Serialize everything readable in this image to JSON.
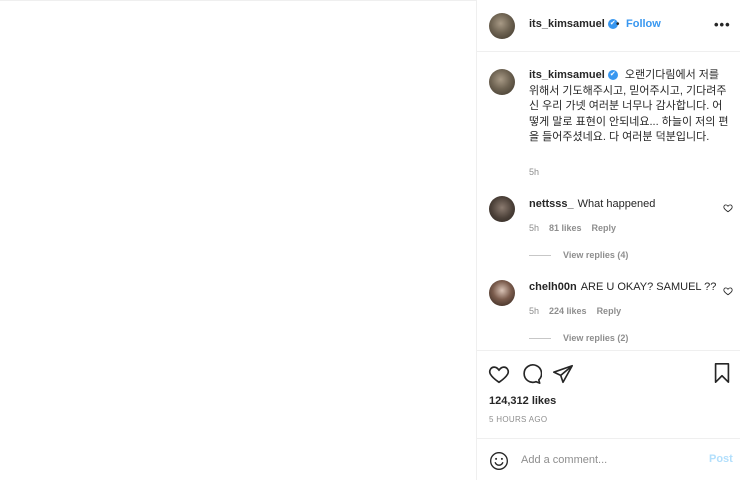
{
  "header": {
    "username": "its_kimsamuel",
    "verified_mark": "✔",
    "separator": "•",
    "follow_label": "Follow",
    "more_label": "•••"
  },
  "caption": {
    "username": "its_kimsamuel",
    "text": "오랜기다림에서 저를 위해서 기도해주시고, 믿어주시고, 기다려주신 우리 가넷 여러분 너무나 감사합니다. 어떻게 말로 표현이 안되네요... 하늘이 저의 편을 들어주셨네요. 다 여러분 덕분입니다.",
    "time": "5h"
  },
  "comments": [
    {
      "username": "nettsss_",
      "text": "What happened",
      "time": "5h",
      "likes": "81 likes",
      "reply_label": "Reply",
      "view_replies": "View replies (4)"
    },
    {
      "username": "chelh00n",
      "text": "ARE U OKAY? SAMUEL ??",
      "time": "5h",
      "likes": "224 likes",
      "reply_label": "Reply",
      "view_replies": "View replies (2)"
    }
  ],
  "post": {
    "likes": "124,312 likes",
    "posted_ago": "5 HOURS AGO"
  },
  "add_comment": {
    "placeholder": "Add a comment...",
    "post_label": "Post"
  },
  "colors": {
    "accent": "#3897f0",
    "muted": "#8e8e8e",
    "border": "#efefef",
    "post_disabled": "#b2dffc"
  },
  "icons": [
    "heart-icon",
    "comment-icon",
    "share-icon",
    "bookmark-icon",
    "emoji-icon",
    "more-icon",
    "verified-icon"
  ]
}
